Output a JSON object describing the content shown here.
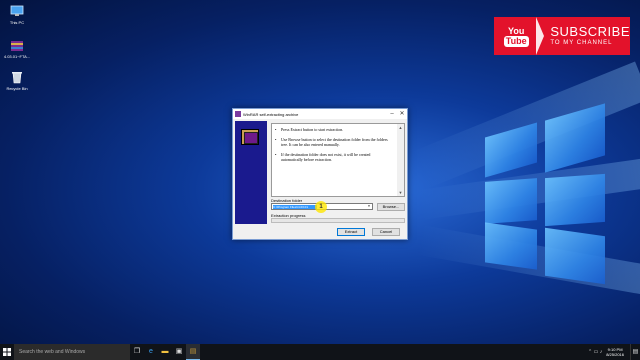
{
  "desktop": {
    "icons": [
      {
        "label": "This PC",
        "icon": "computer-icon"
      },
      {
        "label": "4.03.01~FTA...",
        "icon": "winrar-archive-icon"
      },
      {
        "label": "Recycle Bin",
        "icon": "recycle-bin-icon"
      }
    ]
  },
  "banner": {
    "you": "You",
    "tube": "Tube",
    "subscribe": "SUBSCRIBE",
    "channel": "TO MY CHANNEL"
  },
  "dialog": {
    "title": "WinRAR self-extracting archive",
    "paragraphs": [
      "Press Extract button to start extraction.",
      "Use Browse button to select the destination folder from the folders tree. It can be also entered manually.",
      "If the destination folder does not exist, it will be created automatically before extraction."
    ],
    "destination_label": "Destination folder",
    "destination_value": "C:\\\\Program Files\\\\4.03.01",
    "browse_label": "Browse...",
    "progress_label": "Extraction progress",
    "extract_label": "Extract",
    "cancel_label": "Cancel",
    "cursor_number": "1"
  },
  "taskbar": {
    "search_placeholder": "Search the web and Windows",
    "time": "9:10 PM",
    "date": "8/25/2016"
  },
  "colors": {
    "banner_red": "#e3122b",
    "sidebar_navy": "#1a1a8e",
    "selection_blue": "#3399ff"
  }
}
